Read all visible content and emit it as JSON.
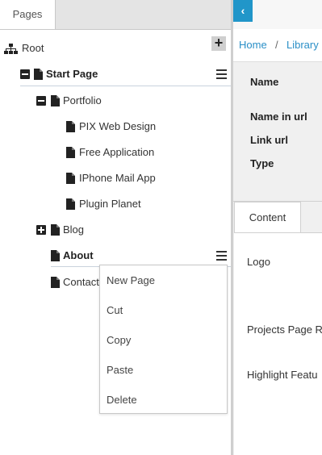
{
  "left_panel": {
    "tab_label": "Pages",
    "tree": {
      "root": "Root",
      "start_page": "Start Page",
      "portfolio": "Portfolio",
      "portfolio_children": [
        "PIX Web Design",
        "Free Application",
        "IPhone Mail App",
        "Plugin Planet"
      ],
      "blog": "Blog",
      "about": "About",
      "contact": "Contact"
    },
    "context_menu": [
      "New Page",
      "Cut",
      "Copy",
      "Paste",
      "Delete"
    ]
  },
  "right_panel": {
    "breadcrumb": [
      "Home",
      "/",
      "Library"
    ],
    "fields": [
      "Name",
      "Name in url",
      "Link url",
      "Type"
    ],
    "tab_label": "Content",
    "content_labels": [
      "Logo",
      "Projects Page R",
      "Highlight Featu"
    ]
  },
  "colors": {
    "accent": "#2196c9",
    "link": "#2a8fc7"
  }
}
